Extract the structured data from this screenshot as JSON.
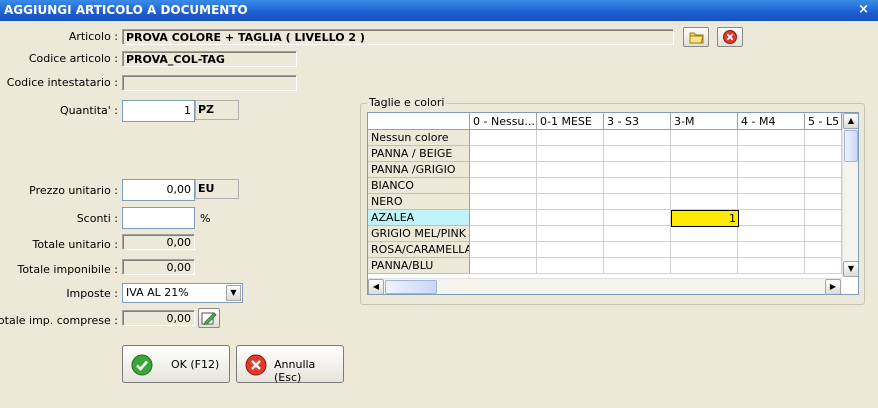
{
  "window": {
    "title": "AGGIUNGI ARTICOLO A DOCUMENTO",
    "close_glyph": "×"
  },
  "form": {
    "articolo_label": "Articolo :",
    "articolo_value": "PROVA COLORE + TAGLIA ( LIVELLO 2 )",
    "codice_articolo_label": "Codice articolo :",
    "codice_articolo_value": "PROVA_COL-TAG",
    "codice_intestatario_label": "Codice intestatario :",
    "codice_intestatario_value": "",
    "quantita_label": "Quantita' :",
    "quantita_value": "1",
    "quantita_unit": "PZ",
    "prezzo_label": "Prezzo unitario :",
    "prezzo_value": "0,00",
    "prezzo_unit": "EU",
    "sconti_label": "Sconti :",
    "sconti_value": "",
    "sconti_unit": "%",
    "totale_unitario_label": "Totale unitario :",
    "totale_unitario_value": "0,00",
    "totale_imponibile_label": "Totale imponibile :",
    "totale_imponibile_value": "0,00",
    "imposte_label": "Imposte :",
    "imposte_value": "IVA AL 21%",
    "totale_imp_label": "Totale imp. comprese :",
    "totale_imp_value": "0,00"
  },
  "buttons": {
    "ok_label": "OK (F12)",
    "annulla_label": "Annulla (Esc)"
  },
  "grid": {
    "group_title": "Taglie e colori",
    "columns": [
      "0 - Nessu...",
      "0-1 MESE",
      "3 - S3",
      "3-M",
      "4 - M4",
      "5 - L5"
    ],
    "rows": [
      "Nessun colore",
      "PANNA / BEIGE",
      "PANNA /GRIGIO",
      "BIANCO",
      "NERO",
      "AZALEA",
      "GRIGIO MEL/PINK",
      "ROSA/CARAMELLA",
      "PANNA/BLU"
    ],
    "selected_row": "AZALEA",
    "highlight_cell_value": "1"
  },
  "colors": {
    "title_bar": "#1c5fd0",
    "highlight_cell": "#ffea00",
    "selected_row": "#bff3f7"
  }
}
